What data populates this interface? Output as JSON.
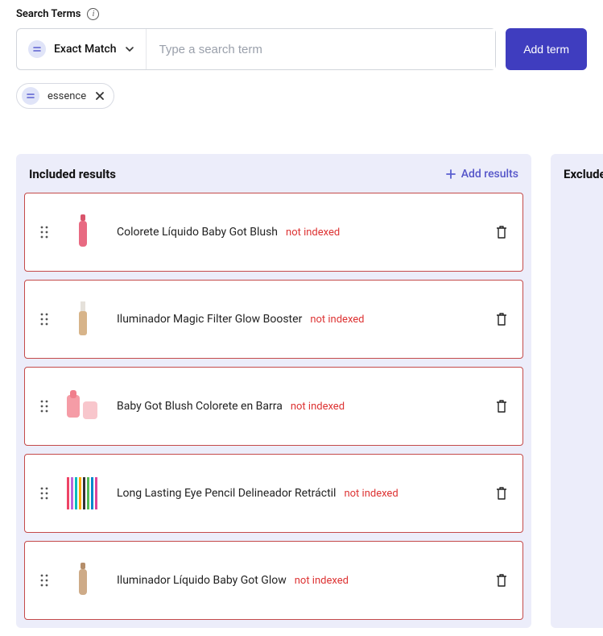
{
  "search": {
    "section_label": "Search Terms",
    "match_mode": "Exact Match",
    "placeholder": "Type a search term",
    "add_button": "Add term",
    "chips": [
      {
        "text": "essence"
      }
    ]
  },
  "included": {
    "title": "Included results",
    "add_label": "Add results",
    "items": [
      {
        "name": "Colorete Líquido Baby Got Blush",
        "status": "not indexed",
        "thumb": "tube-pink"
      },
      {
        "name": "Iluminador Magic Filter Glow Booster",
        "status": "not indexed",
        "thumb": "bottle-tan"
      },
      {
        "name": "Baby Got Blush Colorete en Barra",
        "status": "not indexed",
        "thumb": "stick-pink"
      },
      {
        "name": "Long Lasting Eye Pencil Delineador Retráctil",
        "status": "not indexed",
        "thumb": "pencils"
      },
      {
        "name": "Iluminador Líquido Baby Got Glow",
        "status": "not indexed",
        "thumb": "tube-tan"
      }
    ]
  },
  "excluded": {
    "title": "Excluded"
  }
}
